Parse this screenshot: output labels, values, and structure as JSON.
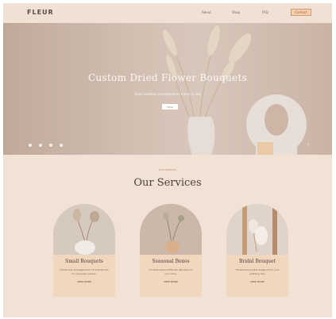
{
  "nav": {
    "logo": "FLEUR",
    "links": [
      "About",
      "Shop",
      "FAQ"
    ],
    "cta": "Contact"
  },
  "hero": {
    "title": "Custom Dried Flower Bouquets",
    "subtitle": "Shop timeless arrangements made to last",
    "button": "Shop"
  },
  "section": {
    "eyebrow": "OUR SERVICES",
    "title": "Our Services"
  },
  "cards": [
    {
      "title": "Small Bouquets",
      "text": "Handmade arrangements of dried florals for everyday spaces.",
      "link": "VIEW MORE"
    },
    {
      "title": "Seasonal Boxes",
      "text": "Curated seasonal florals delivered to your door.",
      "link": "VIEW MORE"
    },
    {
      "title": "Bridal Bouquet",
      "text": "Timeless bouquets designed for your wedding day.",
      "link": "VIEW MORE"
    }
  ],
  "colors": {
    "page": "#f2e2d6",
    "accent": "#d59a72",
    "card": "#f0d7bd"
  }
}
